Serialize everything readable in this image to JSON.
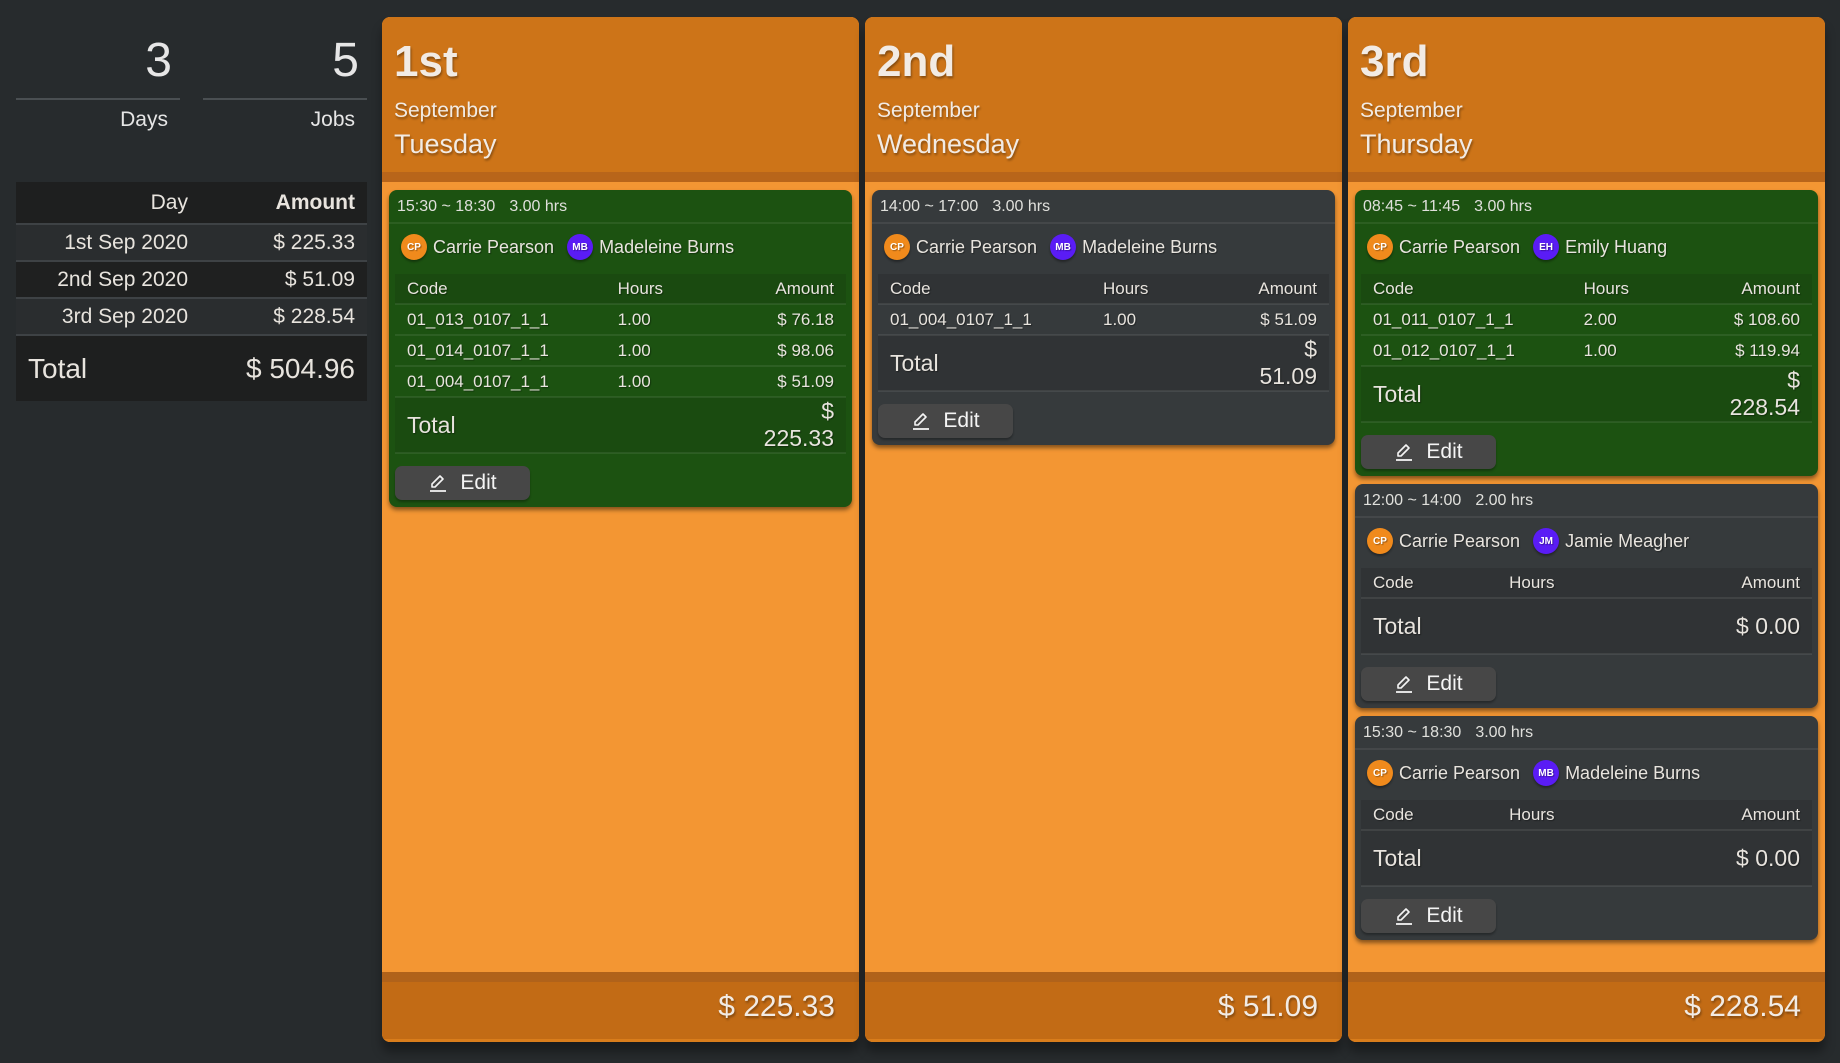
{
  "summary": {
    "stats": [
      {
        "value": "3",
        "label": "Days"
      },
      {
        "value": "5",
        "label": "Jobs"
      }
    ],
    "table": {
      "headers": {
        "day": "Day",
        "amount": "Amount"
      },
      "rows": [
        {
          "day": "1st Sep 2020",
          "amount": "$ 225.33"
        },
        {
          "day": "2nd Sep 2020",
          "amount": "$ 51.09"
        },
        {
          "day": "3rd Sep 2020",
          "amount": "$ 228.54"
        }
      ],
      "total_label": "Total",
      "total_amount": "$ 504.96"
    }
  },
  "colors": {
    "column_header": "#cd7418",
    "column_body": "#f39633",
    "column_footer": "#c26b15",
    "job_approved": "#1c5211",
    "job_pending": "#363a3c",
    "avatar_primary": "#f08a1c",
    "avatar_secondary": "#5a1cf5"
  },
  "table_labels": {
    "code": "Code",
    "hours": "Hours",
    "amount": "Amount",
    "total": "Total",
    "edit": "Edit"
  },
  "days": [
    {
      "ordinal": "1st",
      "month": "September",
      "weekday": "Tuesday",
      "footer_total": "$ 225.33",
      "jobs": [
        {
          "status": "green",
          "time": "15:30 ~ 18:30",
          "duration": "3.00 hrs",
          "people": [
            {
              "initials": "CP",
              "name": "Carrie Pearson",
              "color": "orange"
            },
            {
              "initials": "MB",
              "name": "Madeleine Burns",
              "color": "purple"
            }
          ],
          "lines": [
            {
              "code": "01_013_0107_1_1",
              "hours": "1.00",
              "amount": "$ 76.18"
            },
            {
              "code": "01_014_0107_1_1",
              "hours": "1.00",
              "amount": "$ 98.06"
            },
            {
              "code": "01_004_0107_1_1",
              "hours": "1.00",
              "amount": "$ 51.09"
            }
          ],
          "total": "$ 225.33"
        }
      ]
    },
    {
      "ordinal": "2nd",
      "month": "September",
      "weekday": "Wednesday",
      "footer_total": "$ 51.09",
      "jobs": [
        {
          "status": "dark",
          "time": "14:00 ~ 17:00",
          "duration": "3.00 hrs",
          "people": [
            {
              "initials": "CP",
              "name": "Carrie Pearson",
              "color": "orange"
            },
            {
              "initials": "MB",
              "name": "Madeleine Burns",
              "color": "purple"
            }
          ],
          "lines": [
            {
              "code": "01_004_0107_1_1",
              "hours": "1.00",
              "amount": "$ 51.09"
            }
          ],
          "total": "$ 51.09"
        }
      ]
    },
    {
      "ordinal": "3rd",
      "month": "September",
      "weekday": "Thursday",
      "footer_total": "$ 228.54",
      "jobs": [
        {
          "status": "green",
          "time": "08:45 ~ 11:45",
          "duration": "3.00 hrs",
          "people": [
            {
              "initials": "CP",
              "name": "Carrie Pearson",
              "color": "orange"
            },
            {
              "initials": "EH",
              "name": "Emily Huang",
              "color": "purple"
            }
          ],
          "lines": [
            {
              "code": "01_011_0107_1_1",
              "hours": "2.00",
              "amount": "$ 108.60"
            },
            {
              "code": "01_012_0107_1_1",
              "hours": "1.00",
              "amount": "$ 119.94"
            }
          ],
          "total": "$ 228.54"
        },
        {
          "status": "dark",
          "time": "12:00 ~ 14:00",
          "duration": "2.00 hrs",
          "people": [
            {
              "initials": "CP",
              "name": "Carrie Pearson",
              "color": "orange"
            },
            {
              "initials": "JM",
              "name": "Jamie Meagher",
              "color": "purple"
            }
          ],
          "lines": [],
          "total": "$ 0.00"
        },
        {
          "status": "dark",
          "time": "15:30 ~ 18:30",
          "duration": "3.00 hrs",
          "people": [
            {
              "initials": "CP",
              "name": "Carrie Pearson",
              "color": "orange"
            },
            {
              "initials": "MB",
              "name": "Madeleine Burns",
              "color": "purple"
            }
          ],
          "lines": [],
          "total": "$ 0.00"
        }
      ]
    }
  ]
}
